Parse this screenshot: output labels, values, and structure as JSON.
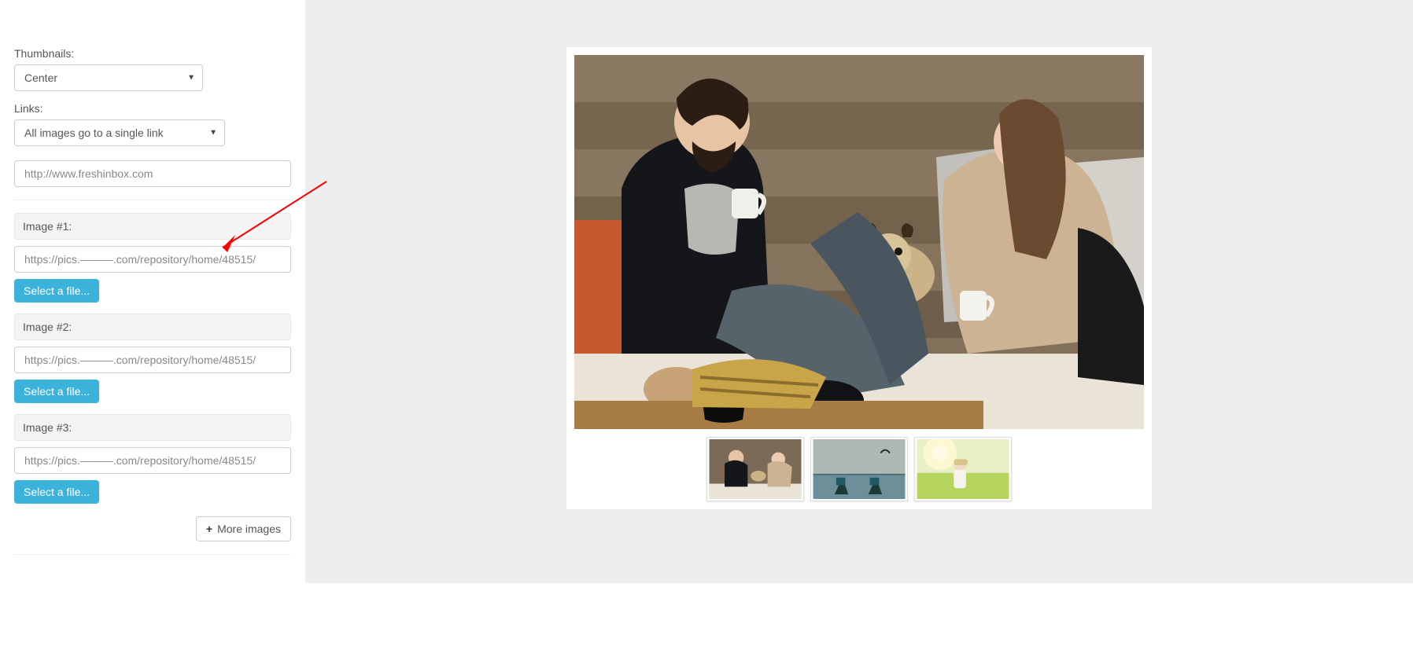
{
  "sidebar": {
    "thumbnails": {
      "label": "Thumbnails:",
      "value": "Center"
    },
    "links": {
      "label": "Links:",
      "value": "All images go to a single link"
    },
    "link_url": {
      "value": "http://www.freshinbox.com"
    },
    "images": [
      {
        "header": "Image #1:",
        "url_prefix": "https://pics.",
        "url_suffix": ".com/repository/home/48515/",
        "select_label": "Select a file..."
      },
      {
        "header": "Image #2:",
        "url_prefix": "https://pics.",
        "url_suffix": ".com/repository/home/48515/",
        "select_label": "Select a file..."
      },
      {
        "header": "Image #3:",
        "url_prefix": "https://pics.",
        "url_suffix": ".com/repository/home/48515/",
        "select_label": "Select a file..."
      }
    ],
    "more_images_label": "More images"
  },
  "preview": {
    "main_image_alt": "Two people with a pug dog sitting on a couch against a wooden wall, holding mugs",
    "thumbs": [
      {
        "alt": "couple with dog on couch"
      },
      {
        "alt": "deck chairs by the sea with a bird"
      },
      {
        "alt": "person in a sunny grass field"
      }
    ]
  }
}
